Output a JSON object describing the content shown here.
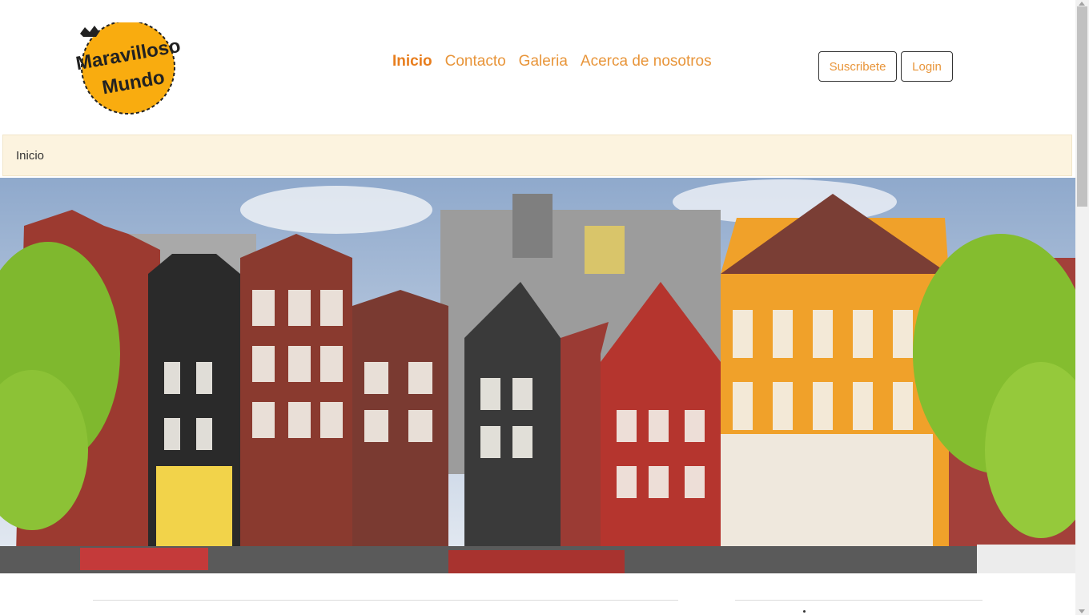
{
  "logo": {
    "line1": "Maravilloso",
    "line2": "Mundo",
    "fill_color": "#f9ac0f"
  },
  "nav": {
    "items": [
      {
        "label": "Inicio",
        "active": true
      },
      {
        "label": "Contacto",
        "active": false
      },
      {
        "label": "Galeria",
        "active": false
      },
      {
        "label": "Acerca de nosotros",
        "active": false
      }
    ],
    "accent_color": "#e8953a"
  },
  "auth": {
    "subscribe_label": "Suscribete",
    "login_label": "Login"
  },
  "breadcrumb": {
    "current": "Inicio"
  },
  "hero": {
    "icon": "amsterdam-canal-houses-photo"
  }
}
